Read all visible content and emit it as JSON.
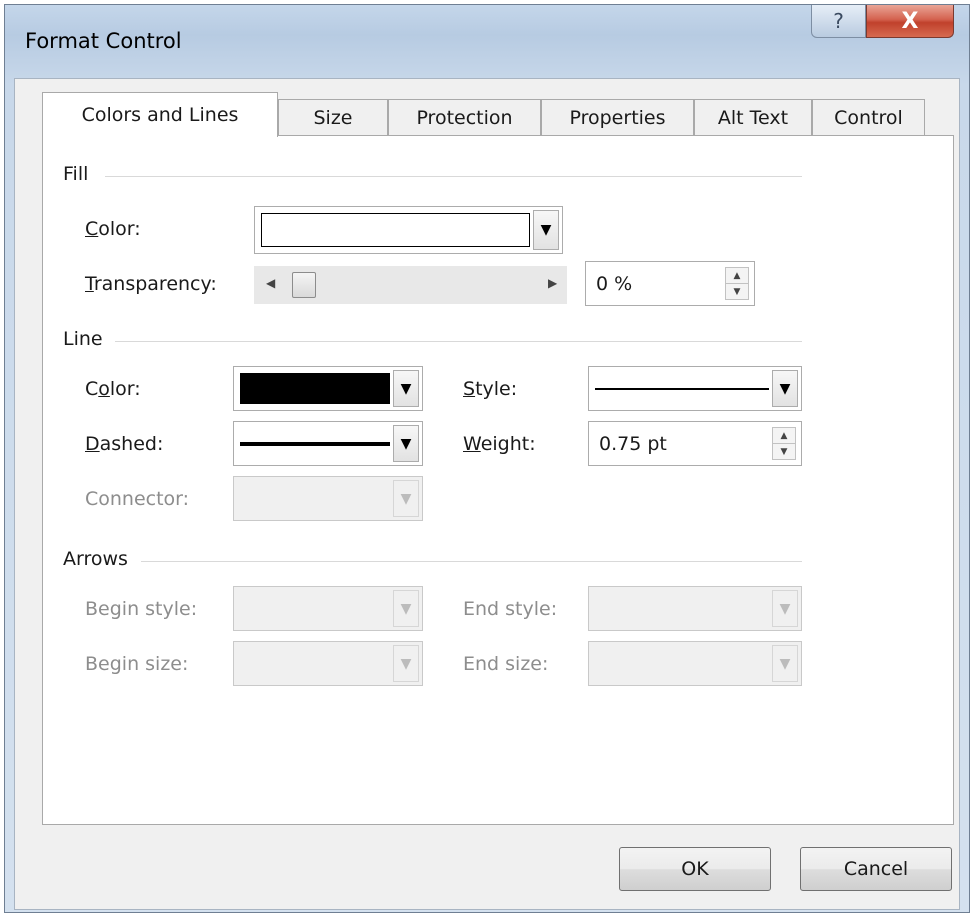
{
  "window": {
    "title": "Format Control",
    "help_glyph": "?",
    "close_glyph": "X"
  },
  "tabs": [
    {
      "label": "Colors and Lines",
      "active": true
    },
    {
      "label": "Size",
      "active": false
    },
    {
      "label": "Protection",
      "active": false
    },
    {
      "label": "Properties",
      "active": false
    },
    {
      "label": "Alt Text",
      "active": false
    },
    {
      "label": "Control",
      "active": false
    }
  ],
  "fill": {
    "group_label": "Fill",
    "color_label_prefix": "C",
    "color_label_rest": "olor:",
    "color_value": "#ffffff",
    "transparency_label_prefix": "T",
    "transparency_label_rest": "ransparency:",
    "transparency_value": "0 %",
    "transparency_fraction": 0.0
  },
  "line": {
    "group_label": "Line",
    "color_label_prefix": "C",
    "color_label_u": "o",
    "color_label_rest": "lor:",
    "color_value": "#000000",
    "dashed_label_prefix": "D",
    "dashed_label_rest": "ashed:",
    "connector_label": "Connector:",
    "style_label_prefix": "S",
    "style_label_rest": "tyle:",
    "weight_label_prefix": "W",
    "weight_label_rest": "eight:",
    "weight_value": "0.75 pt"
  },
  "arrows": {
    "group_label": "Arrows",
    "begin_style_label": "Begin style:",
    "begin_size_label": "Begin size:",
    "end_style_label": "End style:",
    "end_size_label": "End size:"
  },
  "buttons": {
    "ok_label": "OK",
    "cancel_label": "Cancel"
  },
  "icons": {
    "dropdown_arrow": "▼",
    "slider_left": "◀",
    "slider_right": "▶",
    "spin_up": "▲",
    "spin_down": "▼"
  }
}
